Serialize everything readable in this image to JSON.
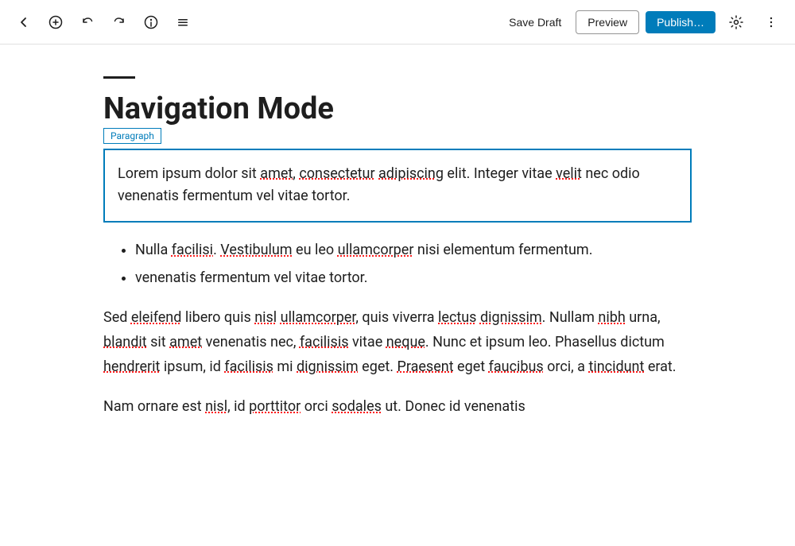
{
  "toolbar": {
    "save_draft_label": "Save Draft",
    "preview_label": "Preview",
    "publish_label": "Publish…",
    "back_icon": "←",
    "add_icon": "⊕",
    "undo_icon": "↩",
    "redo_icon": "↪",
    "info_icon": "ℹ",
    "menu_icon": "≡",
    "settings_icon": "⚙",
    "more_icon": "⋮"
  },
  "content": {
    "title": "Navigation Mode",
    "block_label": "Paragraph",
    "paragraph_1": "Lorem ipsum dolor sit amet, consectetur adipiscing elit. Integer vitae velit nec odio venenatis fermentum vel vitae tortor.",
    "list_items": [
      "Nulla facilisi. Vestibulum eu leo ullamcorper nisi elementum fermentum.",
      "venenatis fermentum vel vitae tortor."
    ],
    "paragraph_2": "Sed eleifend libero quis nisl ullamcorper, quis viverra lectus dignissim. Nullam nibh urna, blandit sit amet venenatis nec, facilisis vitae neque. Nunc et ipsum leo. Phasellus dictum hendrerit ipsum, id facilisis mi dignissim eget. Praesent eget faucibus orci, a tincidunt erat.",
    "paragraph_3": "Nam ornare est nisl, id porttitor orci sodales ut. Donec id venenatis"
  },
  "colors": {
    "blue_accent": "#007cba",
    "text_primary": "#1e1e1e",
    "border_light": "#e0e0e0"
  }
}
